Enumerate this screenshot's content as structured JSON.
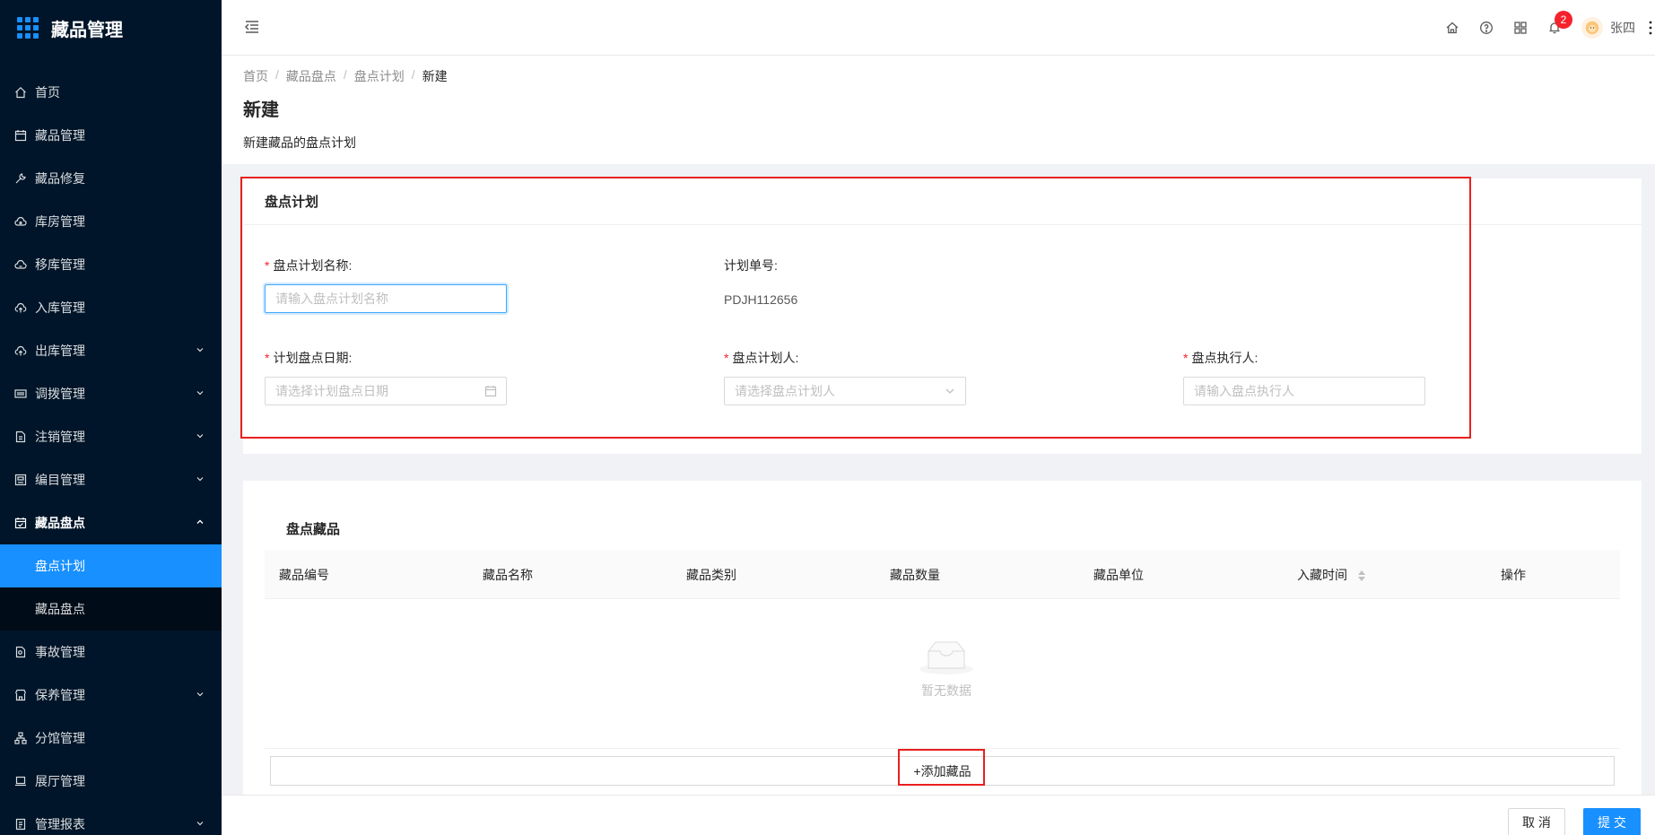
{
  "app": {
    "title": "藏品管理"
  },
  "sidebar": {
    "items": [
      {
        "label": "首页",
        "icon": "home-icon"
      },
      {
        "label": "藏品管理",
        "icon": "calendar-icon"
      },
      {
        "label": "藏品修复",
        "icon": "wrench-icon"
      },
      {
        "label": "库房管理",
        "icon": "cloud-icon"
      },
      {
        "label": "移库管理",
        "icon": "cloud-sync-icon"
      },
      {
        "label": "入库管理",
        "icon": "cloud-upload-icon"
      },
      {
        "label": "出库管理",
        "icon": "cloud-upload-icon"
      },
      {
        "label": "调拨管理",
        "icon": "barcode-icon"
      },
      {
        "label": "注销管理",
        "icon": "file-icon"
      },
      {
        "label": "编目管理",
        "icon": "catalog-icon"
      },
      {
        "label": "藏品盘点",
        "icon": "calendar-check-icon"
      },
      {
        "label": "事故管理",
        "icon": "file-search-icon"
      },
      {
        "label": "保养管理",
        "icon": "shop-icon"
      },
      {
        "label": "分馆管理",
        "icon": "cluster-icon"
      },
      {
        "label": "展厅管理",
        "icon": "laptop-icon"
      },
      {
        "label": "管理报表",
        "icon": "report-icon"
      }
    ],
    "submenu": [
      {
        "label": "盘点计划"
      },
      {
        "label": "藏品盘点"
      }
    ]
  },
  "header": {
    "notification_count": "2",
    "username": "张四"
  },
  "breadcrumb": [
    "首页",
    "藏品盘点",
    "盘点计划",
    "新建"
  ],
  "page": {
    "title": "新建",
    "description": "新建藏品的盘点计划"
  },
  "plan_card": {
    "title": "盘点计划",
    "name_label": "盘点计划名称:",
    "name_placeholder": "请输入盘点计划名称",
    "number_label": "计划单号:",
    "number_value": "PDJH112656",
    "date_label": "计划盘点日期:",
    "date_placeholder": "请选择计划盘点日期",
    "planner_label": "盘点计划人:",
    "planner_placeholder": "请选择盘点计划人",
    "executor_label": "盘点执行人:",
    "executor_placeholder": "请输入盘点执行人"
  },
  "items_card": {
    "title": "盘点藏品",
    "columns": [
      "藏品编号",
      "藏品名称",
      "藏品类别",
      "藏品数量",
      "藏品单位",
      "入藏时间",
      "操作"
    ],
    "empty_text": "暂无数据",
    "add_button": "+添加藏品"
  },
  "footer": {
    "cancel": "取 消",
    "submit": "提 交"
  },
  "colors": {
    "sidebar_bg": "#001529",
    "accent": "#1890ff",
    "highlight_box": "#e8201e",
    "badge": "#f5222d"
  }
}
